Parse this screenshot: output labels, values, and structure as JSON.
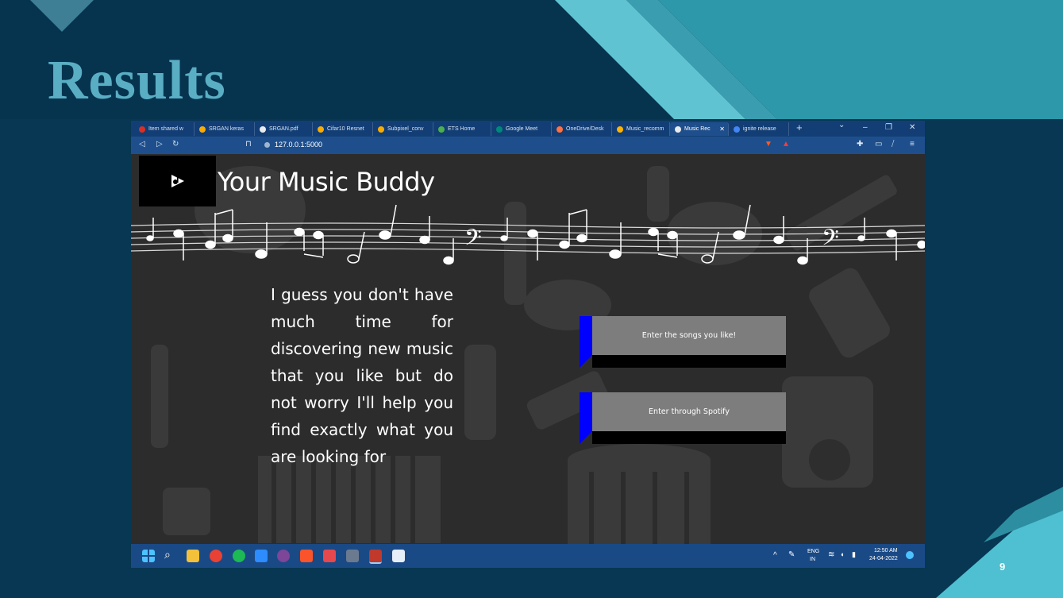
{
  "slide": {
    "title": "Results",
    "page_number": "9"
  },
  "browser": {
    "tabs": [
      {
        "label": "Item shared w",
        "icon_color": "#d93025"
      },
      {
        "label": "SRGAN keras",
        "icon_color": "#f9ab00"
      },
      {
        "label": "SRGAN.pdf",
        "icon_color": "#e8eaed"
      },
      {
        "label": "Cifar10 Resnet",
        "icon_color": "#f9ab00"
      },
      {
        "label": "Subpixel_conv",
        "icon_color": "#f9ab00"
      },
      {
        "label": "ETS Home",
        "icon_color": "#4caf50"
      },
      {
        "label": "Google Meet",
        "icon_color": "#00897b"
      },
      {
        "label": "OneDrive/Desk",
        "icon_color": "#ff7043"
      },
      {
        "label": "Music_recomm",
        "icon_color": "#ffb300"
      },
      {
        "label": "Music Rec",
        "icon_color": "#e8eaed",
        "active": true
      },
      {
        "label": "ignite release",
        "icon_color": "#4285f4"
      }
    ],
    "new_tab": "+",
    "url": "127.0.0.1:5000",
    "window_controls": {
      "minimize": "–",
      "maximize": "❐",
      "close": "✕",
      "tab_search": "⌄"
    }
  },
  "app": {
    "title": "Your Music Buddy",
    "intro_text": "I guess you don't have much time for discovering new music that you like but do not worry I'll help you find exactly what you are looking for",
    "buttons": {
      "songs": "Enter the songs you like!",
      "spotify": "Enter through Spotify"
    },
    "button_colors": {
      "face": "#7d7d7d",
      "side": "#0000ff",
      "shadow": "#000000"
    }
  },
  "taskbar": {
    "lang_top": "ENG",
    "lang_bottom": "IN",
    "time": "12:50 AM",
    "date": "24-04-2022"
  },
  "colors": {
    "slide_bg": "#073752",
    "title": "#5aaec4",
    "teal_accent": "#3bb5c6",
    "browser": "#1e4f8c"
  }
}
